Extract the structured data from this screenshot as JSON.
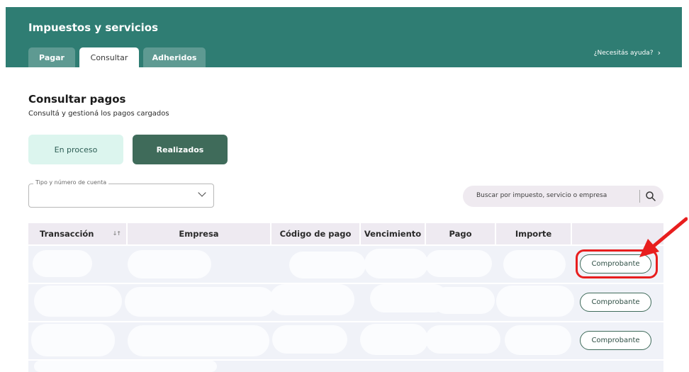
{
  "header": {
    "title": "Impuestos y servicios",
    "tabs": [
      {
        "label": "Pagar",
        "active": false
      },
      {
        "label": "Consultar",
        "active": true
      },
      {
        "label": "Adheridos",
        "active": false
      }
    ],
    "help_link": "¿Necesitás ayuda?",
    "help_icon": "chevron-right-icon",
    "color": "#2f7d73"
  },
  "page": {
    "title": "Consultar pagos",
    "subtitle": "Consultá y gestioná los pagos cargados"
  },
  "segments": {
    "in_process": "En proceso",
    "done": "Realizados",
    "selected": "Realizados"
  },
  "account_select": {
    "label": "Tipo y número de cuenta",
    "value": ""
  },
  "search": {
    "placeholder": "Buscar por impuesto, servicio o empresa",
    "icon": "search-icon"
  },
  "table": {
    "columns": [
      "Transacción",
      "Empresa",
      "Código de pago",
      "Vencimiento",
      "Pago",
      "Importe",
      ""
    ],
    "sort_icon": "↓↑",
    "rows": [
      {
        "action": "Comprobante",
        "highlighted": true
      },
      {
        "action": "Comprobante",
        "highlighted": false
      },
      {
        "action": "Comprobante",
        "highlighted": false
      }
    ]
  },
  "colors": {
    "accent": "#3f6b5a",
    "highlight": "#e81e1e"
  }
}
